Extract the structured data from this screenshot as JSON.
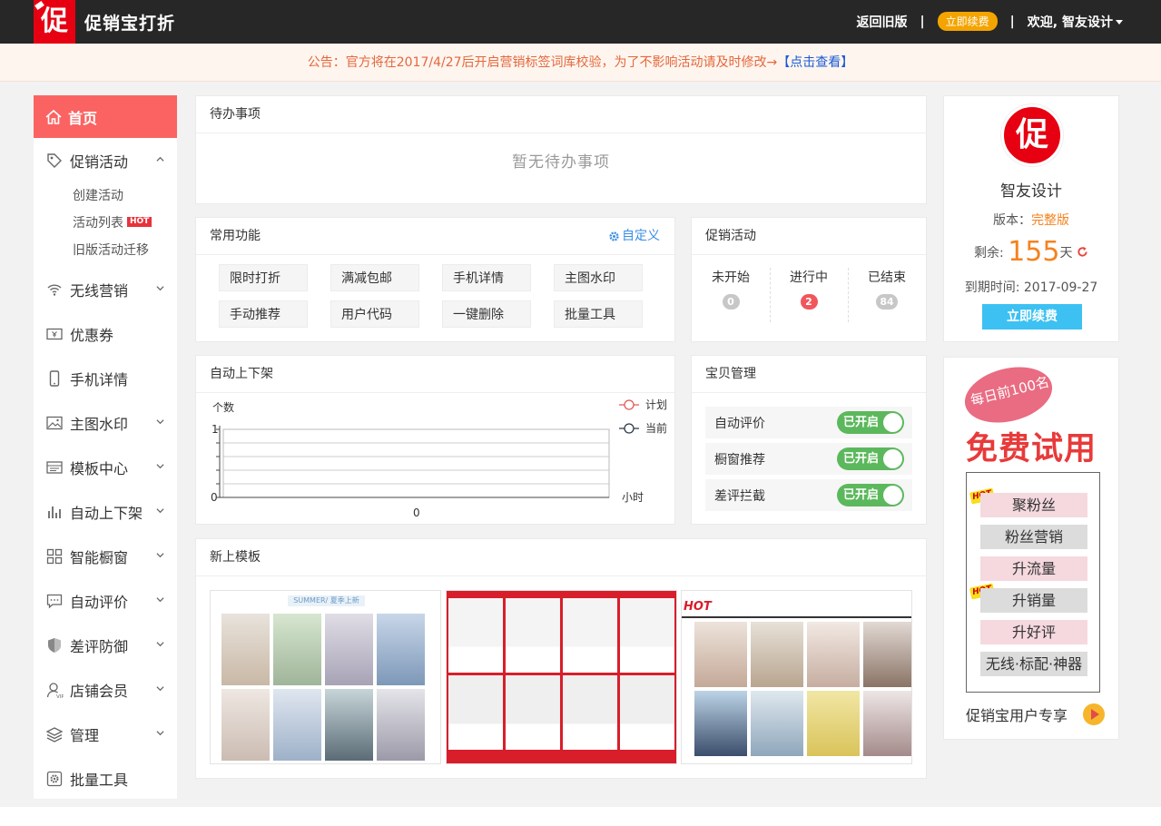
{
  "header": {
    "logo_glyph": "促",
    "title": "促销宝打折",
    "back_old": "返回旧版",
    "renew": "立即续费",
    "welcome": "欢迎, 智友设计",
    "sep1": "|",
    "sep2": "|"
  },
  "notice": {
    "text": "公告：官方将在2017/4/27后开启营销标签词库校验，为了不影响活动请及时修改→",
    "link": "【点击查看】"
  },
  "sidebar": {
    "home": "首页",
    "promo": "促销活动",
    "promo_subs": [
      "创建活动",
      "活动列表",
      "旧版活动迁移"
    ],
    "hot": "HOT",
    "items": [
      {
        "label": "无线营销",
        "icon": "wifi-icon",
        "chevron": true
      },
      {
        "label": "优惠券",
        "icon": "coupon-icon",
        "chevron": false
      },
      {
        "label": "手机详情",
        "icon": "phone-icon",
        "chevron": false
      },
      {
        "label": "主图水印",
        "icon": "image-icon",
        "chevron": true
      },
      {
        "label": "模板中心",
        "icon": "template-icon",
        "chevron": true
      },
      {
        "label": "自动上下架",
        "icon": "bars-icon",
        "chevron": true
      },
      {
        "label": "智能橱窗",
        "icon": "grid-icon",
        "chevron": true
      },
      {
        "label": "自动评价",
        "icon": "comment-icon",
        "chevron": true
      },
      {
        "label": "差评防御",
        "icon": "shield-icon",
        "chevron": true
      },
      {
        "label": "店铺会员",
        "icon": "vip-icon",
        "chevron": true
      },
      {
        "label": "管理",
        "icon": "layers-icon",
        "chevron": true
      },
      {
        "label": "批量工具",
        "icon": "tools-icon",
        "chevron": false
      }
    ]
  },
  "todo": {
    "title": "待办事项",
    "empty": "暂无待办事项"
  },
  "functions": {
    "title": "常用功能",
    "custom": "自定义",
    "buttons": [
      "限时打折",
      "满减包邮",
      "手机详情",
      "主图水印",
      "手动推荐",
      "用户代码",
      "一键删除",
      "批量工具"
    ]
  },
  "promotions": {
    "title": "促销活动",
    "cols": [
      {
        "label": "未开始",
        "count": "0"
      },
      {
        "label": "进行中",
        "count": "2"
      },
      {
        "label": "已结束",
        "count": "84"
      }
    ]
  },
  "auto_shelf": {
    "title": "自动上下架",
    "chart_data": {
      "type": "line",
      "ylabel": "个数",
      "xlabel": "小时",
      "y_ticks": [
        "1",
        "0"
      ],
      "x_ticks": [
        "0"
      ],
      "ylim": [
        0,
        1
      ],
      "legend_position": "top-right",
      "series": [
        {
          "name": "计划",
          "color": "#e05a5a",
          "values": []
        },
        {
          "name": "当前",
          "color": "#2b3a4a",
          "values": []
        }
      ]
    }
  },
  "item_mgmt": {
    "title": "宝贝管理",
    "rows": [
      {
        "label": "自动评价",
        "state": "已开启"
      },
      {
        "label": "橱窗推荐",
        "state": "已开启"
      },
      {
        "label": "差评拦截",
        "state": "已开启"
      }
    ]
  },
  "new_templates": {
    "title": "新上模板",
    "tpl1_banner": "SUMMER/ 夏季上新",
    "tpl3_banner": "HOT"
  },
  "account": {
    "name": "智友设计",
    "version_label": "版本：",
    "version_value": "完整版",
    "remaining_label": "剩余:",
    "remaining_days": "155",
    "remaining_unit": "天",
    "expire_label": "到期时间:",
    "expire_date": "2017-09-27",
    "renew": "立即续费"
  },
  "ad": {
    "bubble": "每日前100名",
    "title": "免费试用",
    "hot": "HOT",
    "items": [
      "聚粉丝",
      "粉丝营销",
      "升流量",
      "升销量",
      "升好评",
      "无线·标配·神器"
    ],
    "footer": "促销宝用户专享"
  },
  "colors": {
    "accent": "#fb6363",
    "brand_red": "#e60012",
    "switch_green": "#5cb85c",
    "link_blue": "#3a8ee6",
    "renew_orange": "#f4a401"
  }
}
